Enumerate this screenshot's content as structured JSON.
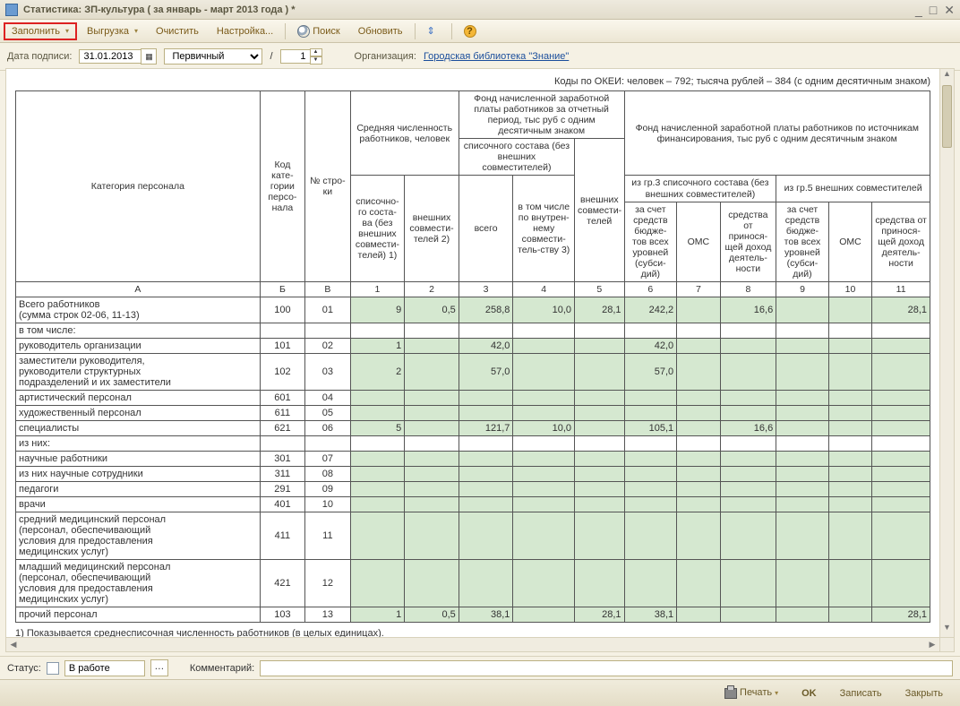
{
  "window": {
    "title": "Статистика: ЗП-культура ( за январь - март 2013 года ) *"
  },
  "toolbar": {
    "fill": "Заполнить",
    "export": "Выгрузка",
    "clear": "Очистить",
    "settings": "Настройка...",
    "search": "Поиск",
    "refresh": "Обновить"
  },
  "params": {
    "date_label": "Дата подписи:",
    "date": "31.01.2013",
    "type": "Первичный",
    "slash": "/",
    "num": "1",
    "org_label": "Организация:",
    "org": "Городская библиотека \"Знание\""
  },
  "topnote": "Коды по ОКЕИ: человек – 792; тысяча рублей – 384 (с одним десятичным знаком)",
  "head": {
    "cat": "Категория персонала",
    "code": "Код кате-гории персо-нала",
    "row": "№ стро-ки",
    "grpA": "Средняя численность работников, человек",
    "grpB": "Фонд начисленной заработной платы работников за отчетный период, тыс руб с одним десятичным знаком",
    "grpC": "Фонд начисленной заработной платы работников по источникам финансирования, тыс руб с одним десятичным знаком",
    "h1": "списочно-го соста-ва (без внешних совмести-телей) 1)",
    "h2": "внешних совмести-телей 2)",
    "h34g": "списочного состава (без внешних совместителей)",
    "h3": "всего",
    "h4": "в том числе по внутрен-нему совмести-тель-ству 3)",
    "h5": "внешних совмести-телей",
    "h678g": "из гр.3 списочного состава (без внешних совместителей)",
    "h91011g": "из гр.5 внешних совместителей",
    "h6": "за счет средств бюдже-тов всех уровней (субси-дий)",
    "h7": "ОМС",
    "h8": "средства от принося-щей доход деятель-ности",
    "h9": "за счет средств бюдже-тов всех уровней (субси-дий)",
    "h10": "ОМС",
    "h11": "средства от принося-щей доход деятель-ности",
    "cA": "А",
    "cB": "Б",
    "cV": "В",
    "c1": "1",
    "c2": "2",
    "c3": "3",
    "c4": "4",
    "c5": "5",
    "c6": "6",
    "c7": "7",
    "c8": "8",
    "c9": "9",
    "c10": "10",
    "c11": "11"
  },
  "rows": {
    "r1": {
      "label1": "Всего работников",
      "label2": "(сумма строк 02-06, 11-13)",
      "code": "100",
      "n": "01",
      "v1": "9",
      "v2": "0,5",
      "v3": "258,8",
      "v4": "10,0",
      "v5": "28,1",
      "v6": "242,2",
      "v8": "16,6",
      "v11": "28,1"
    },
    "r2": {
      "label": "в том числе:"
    },
    "r3": {
      "label": "руководитель организации",
      "code": "101",
      "n": "02",
      "v1": "1",
      "v3": "42,0",
      "v6": "42,0"
    },
    "r4": {
      "label1": "заместители руководителя,",
      "label2": "руководители структурных",
      "label3": "подразделений и их заместители",
      "code": "102",
      "n": "03",
      "v1": "2",
      "v3": "57,0",
      "v6": "57,0"
    },
    "r5": {
      "label": "артистический персонал",
      "code": "601",
      "n": "04"
    },
    "r6": {
      "label": "художественный персонал",
      "code": "611",
      "n": "05"
    },
    "r7": {
      "label": "специалисты",
      "code": "621",
      "n": "06",
      "v1": "5",
      "v3": "121,7",
      "v4": "10,0",
      "v6": "105,1",
      "v8": "16,6"
    },
    "r8": {
      "label": "из них:"
    },
    "r9": {
      "label": "научные работники",
      "code": "301",
      "n": "07"
    },
    "r10": {
      "label": "из них научные сотрудники",
      "code": "311",
      "n": "08"
    },
    "r11": {
      "label": "педагоги",
      "code": "291",
      "n": "09"
    },
    "r12": {
      "label": "врачи",
      "code": "401",
      "n": "10"
    },
    "r13": {
      "label1": "средний медицинский персонал",
      "label2": "(персонал, обеспечивающий",
      "label3": "условия для предоставления",
      "label4": "медицинских услуг)",
      "code": "411",
      "n": "11"
    },
    "r14": {
      "label1": "младший медицинский персонал",
      "label2": "(персонал, обеспечивающий",
      "label3": "условия для предоставления",
      "label4": "медицинских услуг)",
      "code": "421",
      "n": "12"
    },
    "r15": {
      "label": "прочий персонал",
      "code": "103",
      "n": "13",
      "v1": "1",
      "v2": "0,5",
      "v3": "38,1",
      "v5": "28,1",
      "v6": "38,1",
      "v11": "28,1"
    }
  },
  "footnote": "1) Показывается среднесписочная численность работников (в целых единицах).",
  "status": {
    "label": "Статус:",
    "value": "В работе",
    "comment_label": "Комментарий:"
  },
  "bottom": {
    "print": "Печать",
    "ok": "OK",
    "save": "Записать",
    "close": "Закрыть"
  }
}
